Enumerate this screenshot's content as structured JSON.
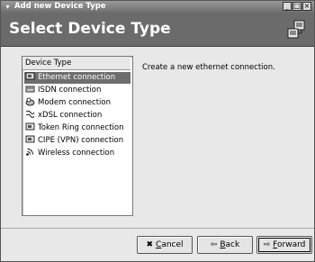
{
  "window": {
    "title": "Add new Device Type",
    "buttons": [
      "minimize",
      "maximize",
      "close"
    ]
  },
  "header": {
    "title": "Select Device Type",
    "icon": "network-device-icon"
  },
  "list": {
    "header": "Device Type",
    "items": [
      {
        "label": "Ethernet connection",
        "icon": "ethernet-card-icon",
        "selected": true
      },
      {
        "label": "ISDN connection",
        "icon": "isdn-card-icon",
        "selected": false
      },
      {
        "label": "Modem connection",
        "icon": "modem-icon",
        "selected": false
      },
      {
        "label": "xDSL connection",
        "icon": "dsl-icon",
        "selected": false
      },
      {
        "label": "Token Ring connection",
        "icon": "token-ring-icon",
        "selected": false
      },
      {
        "label": "CIPE (VPN) connection",
        "icon": "vpn-icon",
        "selected": false
      },
      {
        "label": "Wireless connection",
        "icon": "wireless-icon",
        "selected": false
      }
    ]
  },
  "description": "Create a new ethernet connection.",
  "buttons": {
    "cancel": {
      "pre": "",
      "mn": "C",
      "post": "ancel"
    },
    "back": {
      "pre": "",
      "mn": "B",
      "post": "ack"
    },
    "forward": {
      "pre": "",
      "mn": "F",
      "post": "orward"
    }
  }
}
